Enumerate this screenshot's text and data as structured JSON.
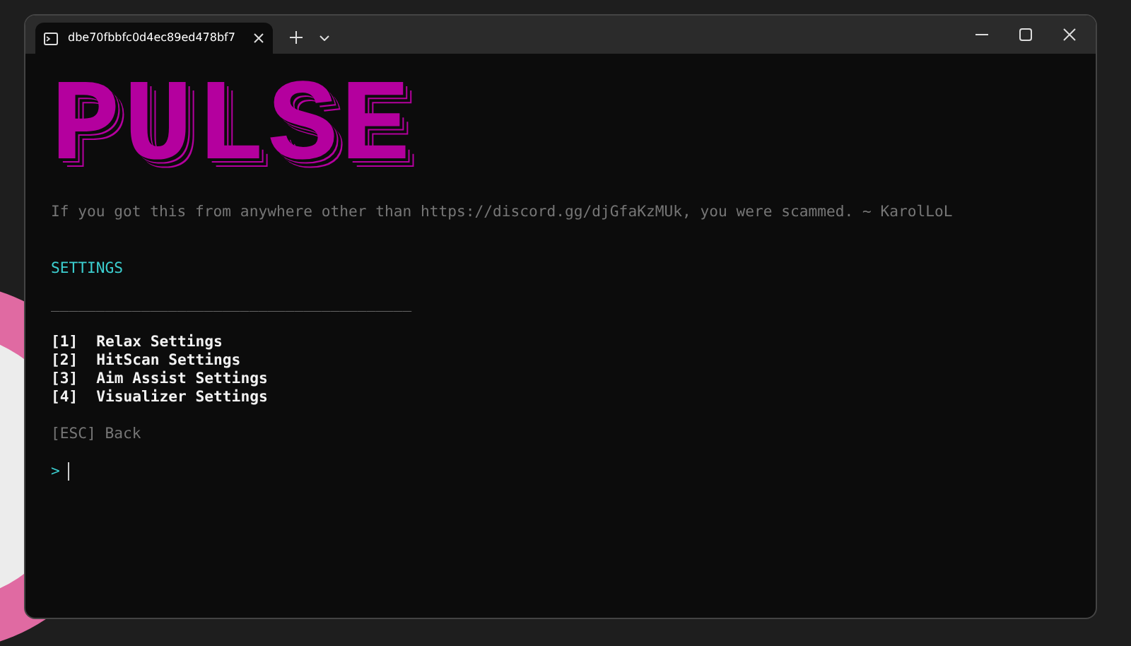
{
  "window": {
    "tab_title": "dbe70fbbfc0d4ec89ed478bf7"
  },
  "terminal": {
    "logo": "PULSE",
    "notice": "If you got this from anywhere other than https://discord.gg/djGfaKzMUk, you were scammed. ~ KarolLoL",
    "heading": "SETTINGS",
    "rule": "________________________________________",
    "menu": [
      {
        "key": "[1]",
        "label": "Relax Settings"
      },
      {
        "key": "[2]",
        "label": "HitScan Settings"
      },
      {
        "key": "[3]",
        "label": "Aim Assist Settings"
      },
      {
        "key": "[4]",
        "label": "Visualizer Settings"
      }
    ],
    "back": "[ESC] Back",
    "prompt": ">"
  }
}
